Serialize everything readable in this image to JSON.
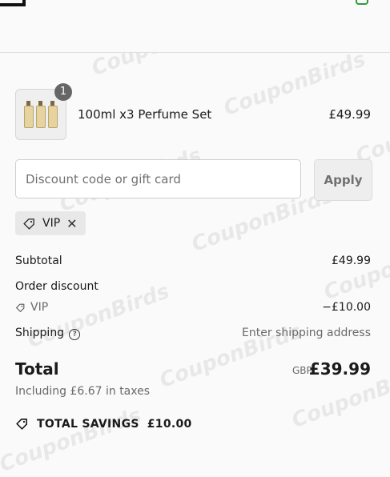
{
  "item": {
    "quantity": "1",
    "title": "100ml x3 Perfume Set",
    "price": "£49.99"
  },
  "discount": {
    "placeholder": "Discount code or gift card",
    "apply_label": "Apply",
    "applied_code": "VIP"
  },
  "summary": {
    "subtotal_label": "Subtotal",
    "subtotal_value": "£49.99",
    "order_discount_label": "Order discount",
    "discount_code": "VIP",
    "discount_value": "−£10.00",
    "shipping_label": "Shipping",
    "shipping_value": "Enter shipping address",
    "total_label": "Total",
    "currency": "GBP",
    "total_value": "£39.99",
    "tax_note": "Including £6.67 in taxes",
    "savings_label": "TOTAL SAVINGS",
    "savings_value": "£10.00"
  },
  "watermark": "CouponBirds",
  "colors": {
    "accent": "#2e9b3a",
    "badge": "#666666",
    "chip_bg": "#e8e8e8"
  }
}
